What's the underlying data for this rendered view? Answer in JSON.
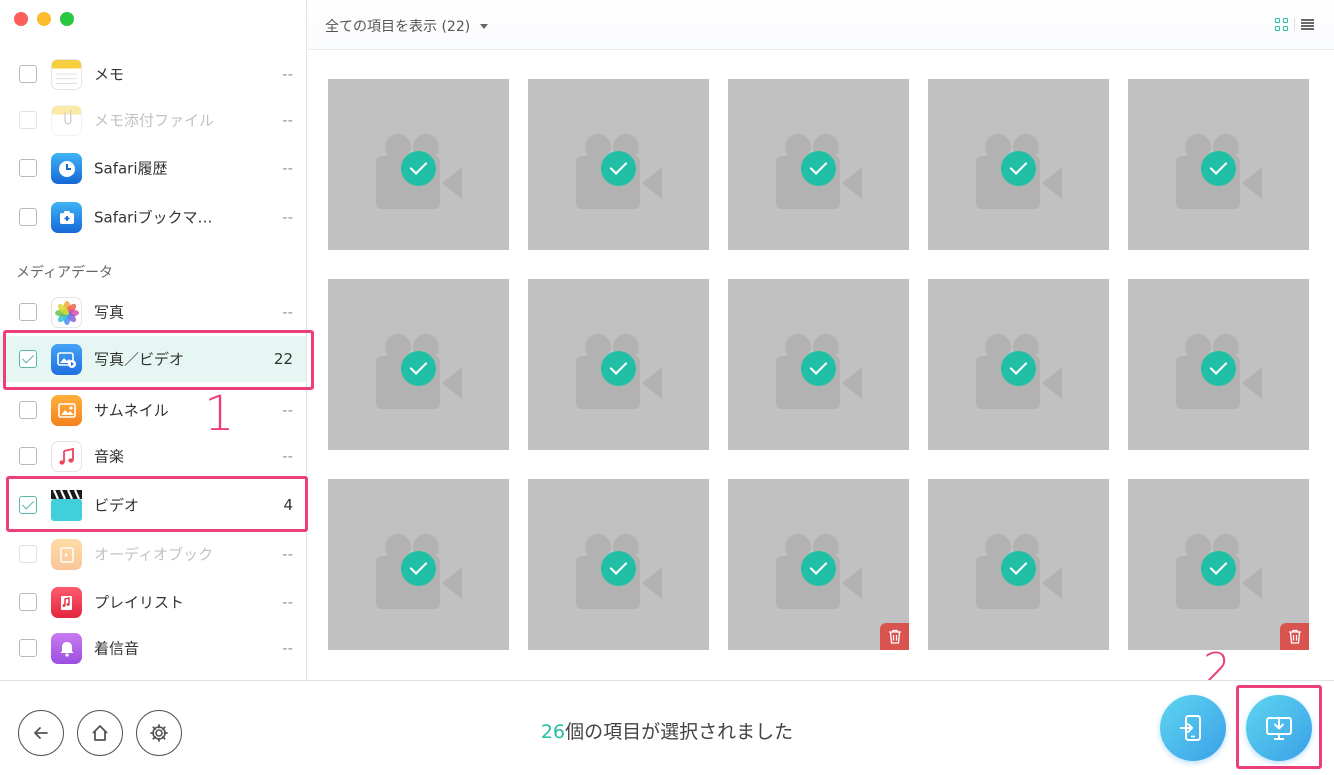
{
  "sidebar": {
    "rows": [
      {
        "label": "メモ",
        "count": "--"
      },
      {
        "label": "メモ添付ファイル",
        "count": "--"
      },
      {
        "label": "Safari履歴",
        "count": "--"
      },
      {
        "label": "Safariブックマ…",
        "count": "--"
      }
    ],
    "section_label": "メディアデータ",
    "media_rows": [
      {
        "label": "写真",
        "count": "--"
      },
      {
        "label": "写真／ビデオ",
        "count": "22"
      },
      {
        "label": "サムネイル",
        "count": "--"
      },
      {
        "label": "音楽",
        "count": "--"
      },
      {
        "label": "ビデオ",
        "count": "4"
      },
      {
        "label": "オーディオブック",
        "count": "--"
      },
      {
        "label": "プレイリスト",
        "count": "--"
      },
      {
        "label": "着信音",
        "count": "--"
      }
    ]
  },
  "annotations": {
    "step1": "1",
    "step2": "2"
  },
  "topbar": {
    "filter_label": "全ての項目を表示 (22)"
  },
  "bottombar": {
    "selected_count": "26",
    "selected_text": "個の項目が選択されました"
  },
  "colors": {
    "accent": "#21bfa6",
    "highlight": "#ec3e78",
    "tile": "#c1c1c1",
    "delete": "#d9534f"
  }
}
